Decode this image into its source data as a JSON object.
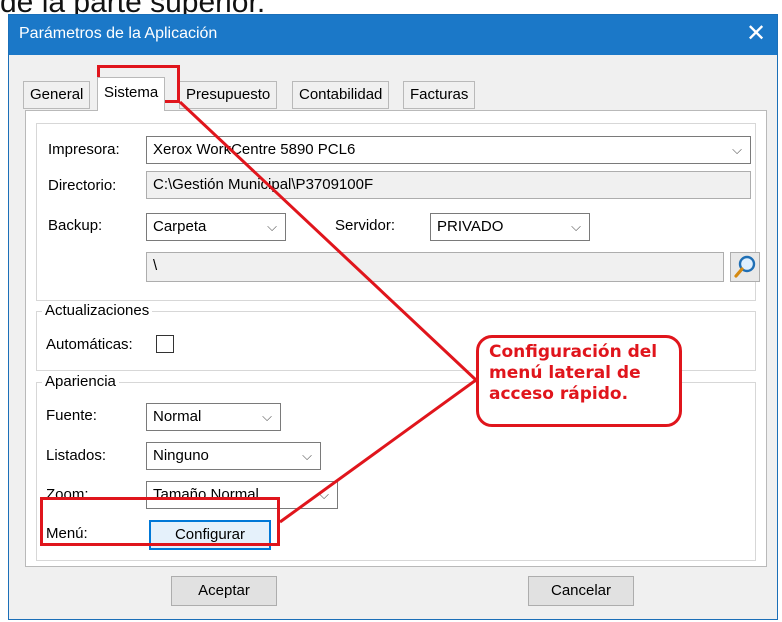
{
  "caption": "de la parte superior.",
  "window": {
    "title": "Parámetros de la Aplicación",
    "close_glyph": "✕"
  },
  "tabs": [
    {
      "label": "General",
      "active": false
    },
    {
      "label": "Sistema",
      "active": true
    },
    {
      "label": "Presupuesto",
      "active": false
    },
    {
      "label": "Contabilidad",
      "active": false
    },
    {
      "label": "Facturas",
      "active": false
    }
  ],
  "system": {
    "printer_label": "Impresora:",
    "printer_value": "Xerox WorkCentre 5890 PCL6",
    "directory_label": "Directorio:",
    "directory_value": "C:\\Gestión Municipal\\P3709100F",
    "backup_label": "Backup:",
    "backup_value": "Carpeta",
    "server_label": "Servidor:",
    "server_value": "PRIVADO",
    "backup_path_value": "\\"
  },
  "updates": {
    "title": "Actualizaciones",
    "automatic_label": "Automáticas:",
    "automatic_checked": false
  },
  "appearance": {
    "title": "Apariencia",
    "font_label": "Fuente:",
    "font_value": "Normal",
    "lists_label": "Listados:",
    "lists_value": "Ninguno",
    "zoom_label": "Zoom:",
    "zoom_value": "Tamaño Normal",
    "menu_label": "Menú:",
    "configure_button": "Configurar"
  },
  "buttons": {
    "accept": "Aceptar",
    "cancel": "Cancelar"
  },
  "annotation": {
    "line1": "Configuración del",
    "line2": "menú lateral de",
    "line3": "acceso rápido."
  },
  "colors": {
    "titlebar": "#1b78c8",
    "annotation_red": "#e0151c",
    "default_button_border": "#0078d7"
  },
  "icons": {
    "dropdown": "chevron-down-icon",
    "search": "magnifier-icon",
    "close": "close-icon"
  }
}
